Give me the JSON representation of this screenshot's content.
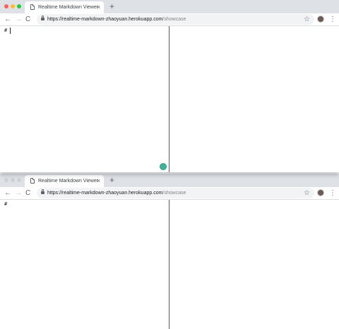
{
  "browser": {
    "tab_title": "Realtime Markdown Viewer",
    "tab_close": "×",
    "new_tab": "+",
    "url_host": "https://realtime-markdown-zhaoyuan.herokuapp.com",
    "url_path": "/showcase",
    "nav_back": "←",
    "nav_forward": "→",
    "nav_reload": "C",
    "bookmark_star": "☆",
    "menu": "⋮"
  },
  "icons": {
    "window_close": "red-circle",
    "window_minimize": "yellow-circle",
    "window_maximize": "green-circle",
    "tab_page": "page-icon",
    "lock": "lock-icon",
    "profile": "avatar",
    "extension": "extension-icon"
  },
  "colors": {
    "traffic_red": "#fe5f57",
    "traffic_yellow": "#febc2e",
    "traffic_green": "#28c840",
    "extension_badge": "#3fb39a"
  },
  "windows": [
    {
      "editor_text": "#"
    },
    {
      "editor_text": "#"
    }
  ]
}
